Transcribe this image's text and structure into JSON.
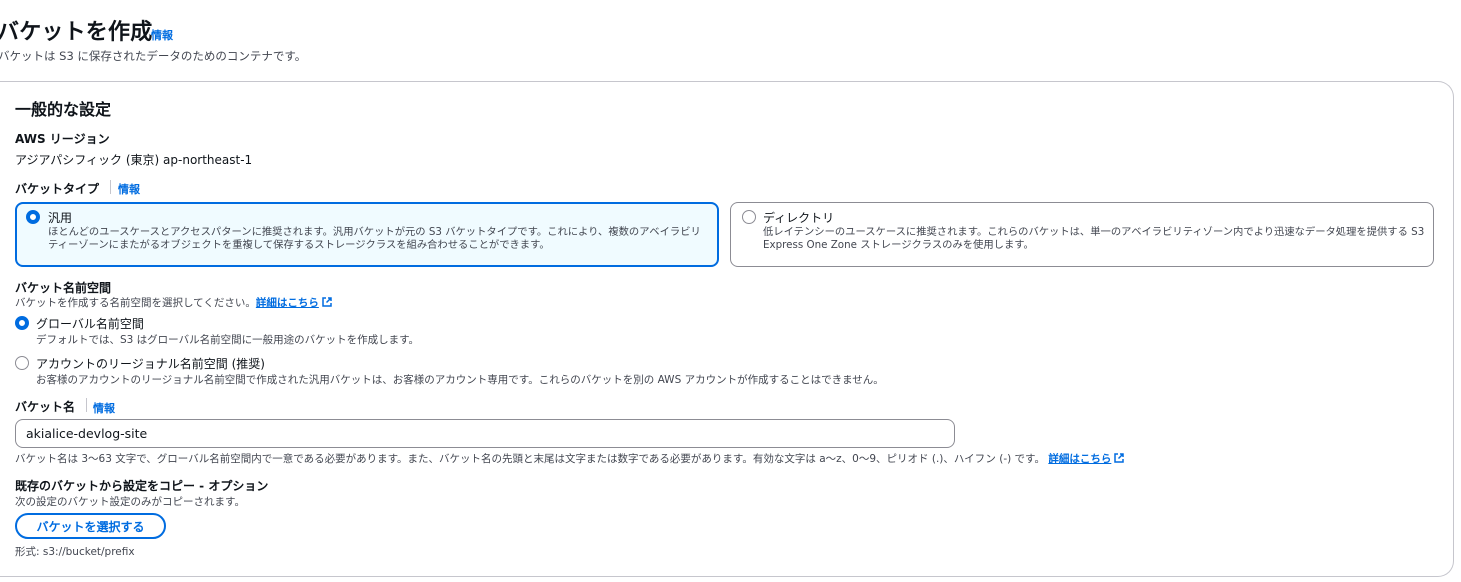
{
  "header": {
    "title": "バケットを作成",
    "info": "情報",
    "description": "バケットは S3 に保存されたデータのためのコンテナです。"
  },
  "general": {
    "title": "一般的な設定",
    "region_label": "AWS リージョン",
    "region_value": "アジアパシフィック (東京) ap-northeast-1",
    "bucket_type_label": "バケットタイプ",
    "bucket_type_info": "情報",
    "bucket_types": [
      {
        "title": "汎用",
        "description": "ほとんどのユースケースとアクセスパターンに推奨されます。汎用バケットが元の S3 バケットタイプです。これにより、複数のアベイラビリティーゾーンにまたがるオブジェクトを重複して保存するストレージクラスを組み合わせることができます。",
        "selected": true
      },
      {
        "title": "ディレクトリ",
        "description": "低レイテンシーのユースケースに推奨されます。これらのバケットは、単一のアベイラビリティゾーン内でより迅速なデータ処理を提供する S3 Express One Zone ストレージクラスのみを使用します。",
        "selected": false
      }
    ],
    "namespace_label": "バケット名前空間",
    "namespace_desc": "バケットを作成する名前空間を選択してください。",
    "namespace_link": "詳細はこちら",
    "namespaces": [
      {
        "title": "グローバル名前空間",
        "description": "デフォルトでは、S3 はグローバル名前空間に一般用途のバケットを作成します。",
        "selected": true
      },
      {
        "title": "アカウントのリージョナル名前空間 (推奨)",
        "description": "お客様のアカウントのリージョナル名前空間で作成された汎用バケットは、お客様のアカウント専用です。これらのバケットを別の AWS アカウントが作成することはできません。",
        "selected": false
      }
    ],
    "bucket_name_label": "バケット名",
    "bucket_name_info": "情報",
    "bucket_name_value": "akialice-devlog-site",
    "bucket_name_hint": "バケット名は 3〜63 文字で、グローバル名前空間内で一意である必要があります。また、バケット名の先頭と末尾は文字または数字である必要があります。有効な文字は a〜z、0〜9、ピリオド (.)、ハイフン (-) です。",
    "bucket_name_link": "詳細はこちら",
    "copy_label": "既存のバケットから設定をコピー - オプション",
    "copy_desc": "次の設定のバケット設定のみがコピーされます。",
    "copy_button": "バケットを選択する",
    "copy_format": "形式: s3://bucket/prefix"
  },
  "colors": {
    "accent": "#006ce0",
    "selected_tile_bg": "#f0fbff",
    "border": "#8c8c94",
    "text_secondary": "#424650"
  }
}
